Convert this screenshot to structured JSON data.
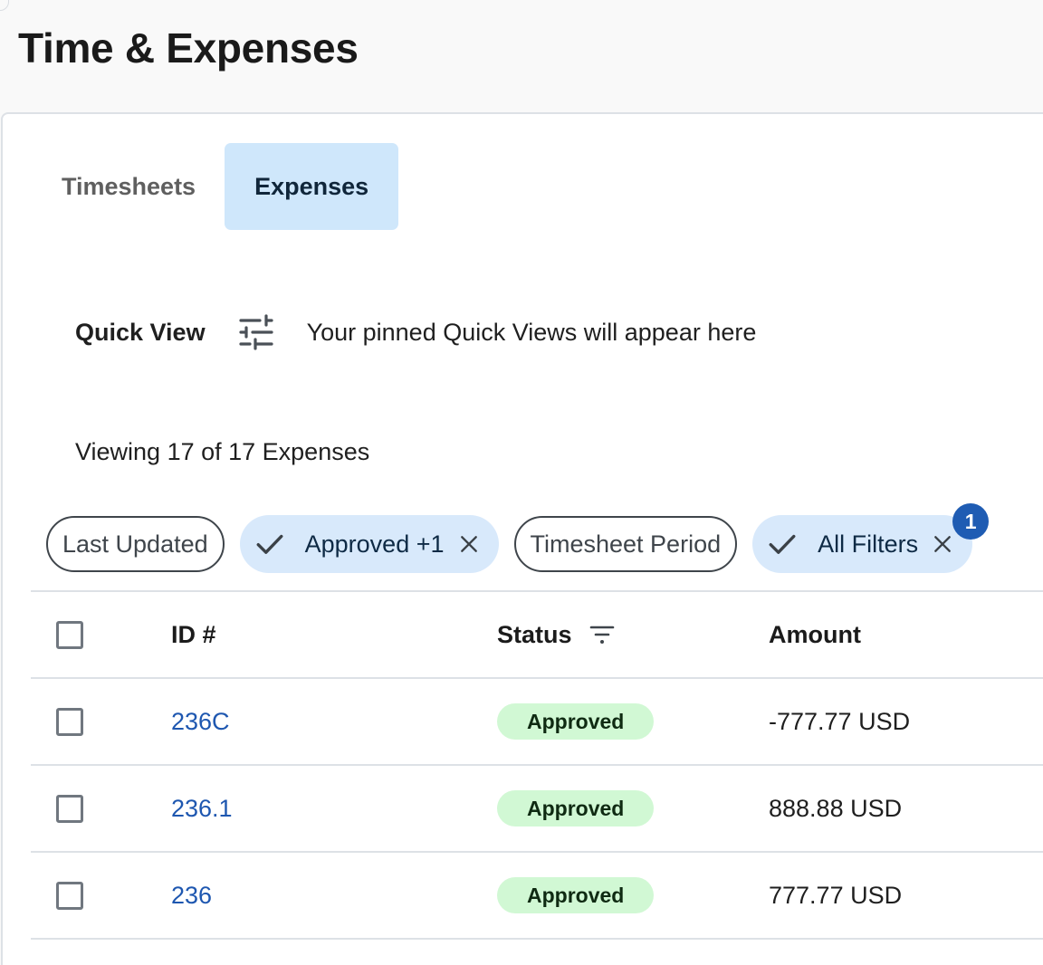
{
  "header": {
    "title": "Time & Expenses"
  },
  "tabs": [
    {
      "label": "Timesheets",
      "active": false
    },
    {
      "label": "Expenses",
      "active": true
    }
  ],
  "quick_view": {
    "label": "Quick View",
    "icon": "tune-sliders-icon",
    "hint": "Your pinned Quick Views will appear here"
  },
  "summary": {
    "viewing_text": "Viewing 17 of 17 Expenses"
  },
  "filters": {
    "last_updated": "Last Updated",
    "approved": "Approved +1",
    "timesheet_period": "Timesheet Period",
    "all_filters": "All Filters",
    "all_filters_badge": "1"
  },
  "table": {
    "columns": {
      "id": "ID #",
      "status": "Status",
      "amount": "Amount"
    },
    "rows": [
      {
        "id": "236C",
        "status": "Approved",
        "amount": "-777.77 USD"
      },
      {
        "id": "236.1",
        "status": "Approved",
        "amount": "888.88 USD"
      },
      {
        "id": "236",
        "status": "Approved",
        "amount": "777.77 USD"
      }
    ]
  },
  "colors": {
    "accent_blue": "#1e57b0",
    "tab_active_bg": "#cfe7fb",
    "chip_selected_bg": "#d8e9fb",
    "badge_bg": "#1f5cb3",
    "status_approved_bg": "#d1f8d4"
  }
}
